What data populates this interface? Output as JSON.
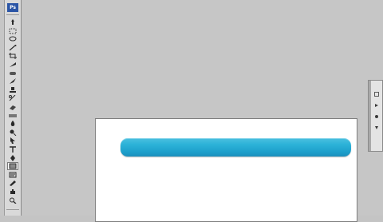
{
  "app": {
    "logo_text": "Ps"
  },
  "toolbox": {
    "tools": [
      {
        "name": "move-tool-icon",
        "selected": false
      },
      {
        "name": "marquee-tool-icon",
        "selected": false
      },
      {
        "name": "lasso-tool-icon",
        "selected": false
      },
      {
        "name": "magic-wand-tool-icon",
        "selected": false
      },
      {
        "name": "crop-tool-icon",
        "selected": false
      },
      {
        "name": "slice-tool-icon",
        "selected": false
      },
      {
        "name": "healing-brush-tool-icon",
        "selected": false
      },
      {
        "name": "brush-tool-icon",
        "selected": false
      },
      {
        "name": "clone-stamp-tool-icon",
        "selected": false
      },
      {
        "name": "history-brush-tool-icon",
        "selected": false
      },
      {
        "name": "eraser-tool-icon",
        "selected": false
      },
      {
        "name": "gradient-tool-icon",
        "selected": false
      },
      {
        "name": "blur-tool-icon",
        "selected": false
      },
      {
        "name": "dodge-tool-icon",
        "selected": false
      },
      {
        "name": "path-selection-tool-icon",
        "selected": false
      },
      {
        "name": "type-tool-icon",
        "selected": false
      },
      {
        "name": "pen-tool-icon",
        "selected": false
      },
      {
        "name": "shape-tool-icon",
        "selected": true
      },
      {
        "name": "notes-tool-icon",
        "selected": false
      },
      {
        "name": "eyedropper-tool-icon",
        "selected": false
      },
      {
        "name": "hand-tool-icon",
        "selected": false
      },
      {
        "name": "zoom-tool-icon",
        "selected": false
      }
    ]
  },
  "canvas": {
    "background_color": "#ffffff",
    "shape": {
      "name": "rounded-rectangle",
      "color_top": "#4bc0e0",
      "color_bottom": "#1c8fbc"
    }
  },
  "colors": {
    "workspace": "#c6c6c6",
    "toolbox": "#d9d9d9",
    "accent": "#2cb2d8"
  }
}
